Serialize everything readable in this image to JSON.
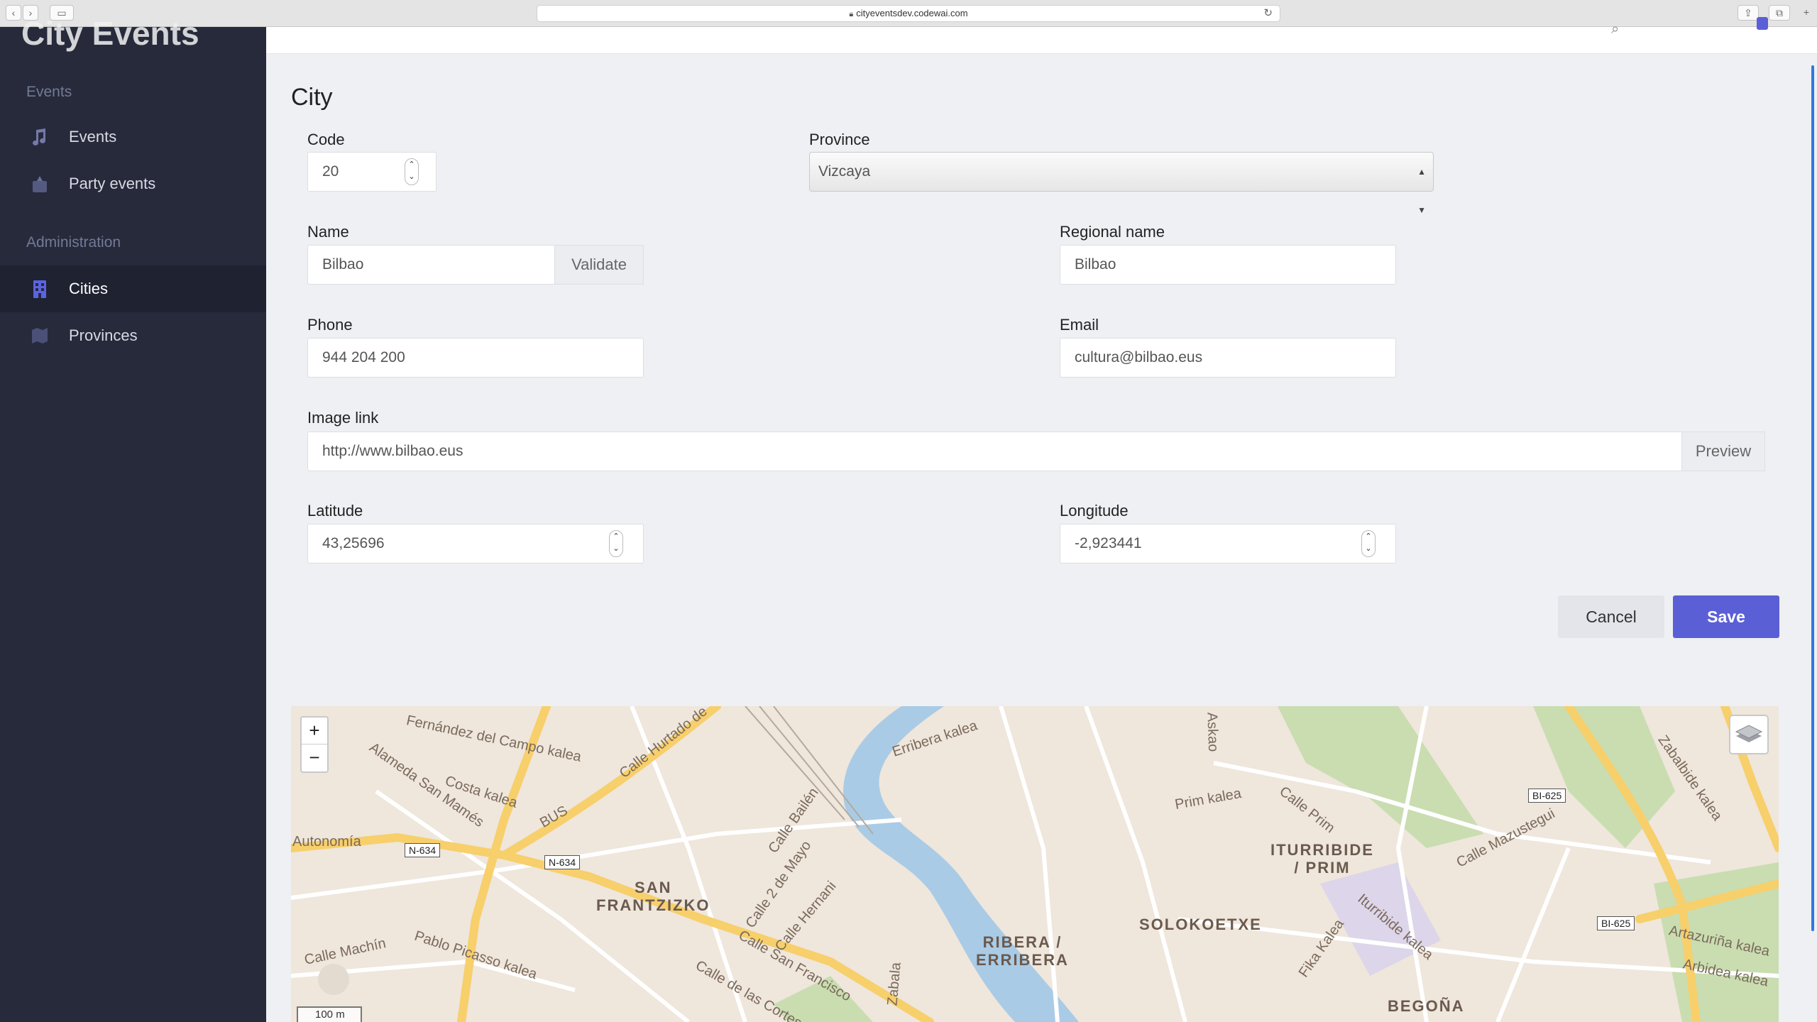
{
  "browser": {
    "url": "cityeventsdev.codewai.com"
  },
  "sidebar": {
    "brand": "City Events",
    "sections": [
      {
        "title": "Events",
        "items": [
          {
            "label": "Events",
            "icon": "music-note-icon"
          },
          {
            "label": "Party events",
            "icon": "party-icon"
          }
        ]
      },
      {
        "title": "Administration",
        "items": [
          {
            "label": "Cities",
            "icon": "building-icon",
            "active": true
          },
          {
            "label": "Provinces",
            "icon": "map-icon"
          }
        ]
      }
    ]
  },
  "form": {
    "title": "City",
    "code": {
      "label": "Code",
      "value": "20"
    },
    "province": {
      "label": "Province",
      "value": "Vizcaya"
    },
    "name": {
      "label": "Name",
      "value": "Bilbao",
      "button": "Validate"
    },
    "regional_name": {
      "label": "Regional name",
      "value": "Bilbao"
    },
    "phone": {
      "label": "Phone",
      "value": "944 204 200"
    },
    "email": {
      "label": "Email",
      "value": "cultura@bilbao.eus"
    },
    "image_link": {
      "label": "Image link",
      "value": "http://www.bilbao.eus",
      "button": "Preview"
    },
    "latitude": {
      "label": "Latitude",
      "value": "43,25696"
    },
    "longitude": {
      "label": "Longitude",
      "value": "-2,923441"
    },
    "cancel": "Cancel",
    "save": "Save"
  },
  "map": {
    "zoom_in": "+",
    "zoom_out": "−",
    "scale": "100 m",
    "labels": [
      "Fernández del Campo kalea",
      "Costa kalea",
      "Autonomía",
      "Calle Hurtado de",
      "Erribera kalea",
      "Prim kalea",
      "Calle Prim",
      "Calle Mazustegui",
      "Zabalbide kalea",
      "Artazuriña kalea",
      "Arbidea kalea",
      "Calle Machín",
      "Pablo Picasso kalea",
      "Calle San Francisco",
      "Calle de las Cortes",
      "Calle Bailén",
      "Calle 2 de Mayo",
      "Calle Hernani",
      "Fika Kalea",
      "Iturribide kalea",
      "Alameda San Mamés",
      "BUS",
      "Askao",
      "Zabala"
    ],
    "districts": [
      "SAN\nFRANTZIZKO",
      "RIBERA /\nERRIBERA",
      "ITURRIBIDE\n/ PRIM",
      "SOLOKOETXE",
      "BEGOÑA"
    ],
    "shields": [
      "N-634",
      "N-634",
      "BI-625",
      "BI-625"
    ],
    "colors": {
      "water": "#a9cbe6",
      "road_major": "#f7cf6b",
      "road_minor": "#ffffff",
      "park": "#c9ddb1",
      "land": "#efe6dc"
    }
  },
  "accent": "#5b5fd6"
}
